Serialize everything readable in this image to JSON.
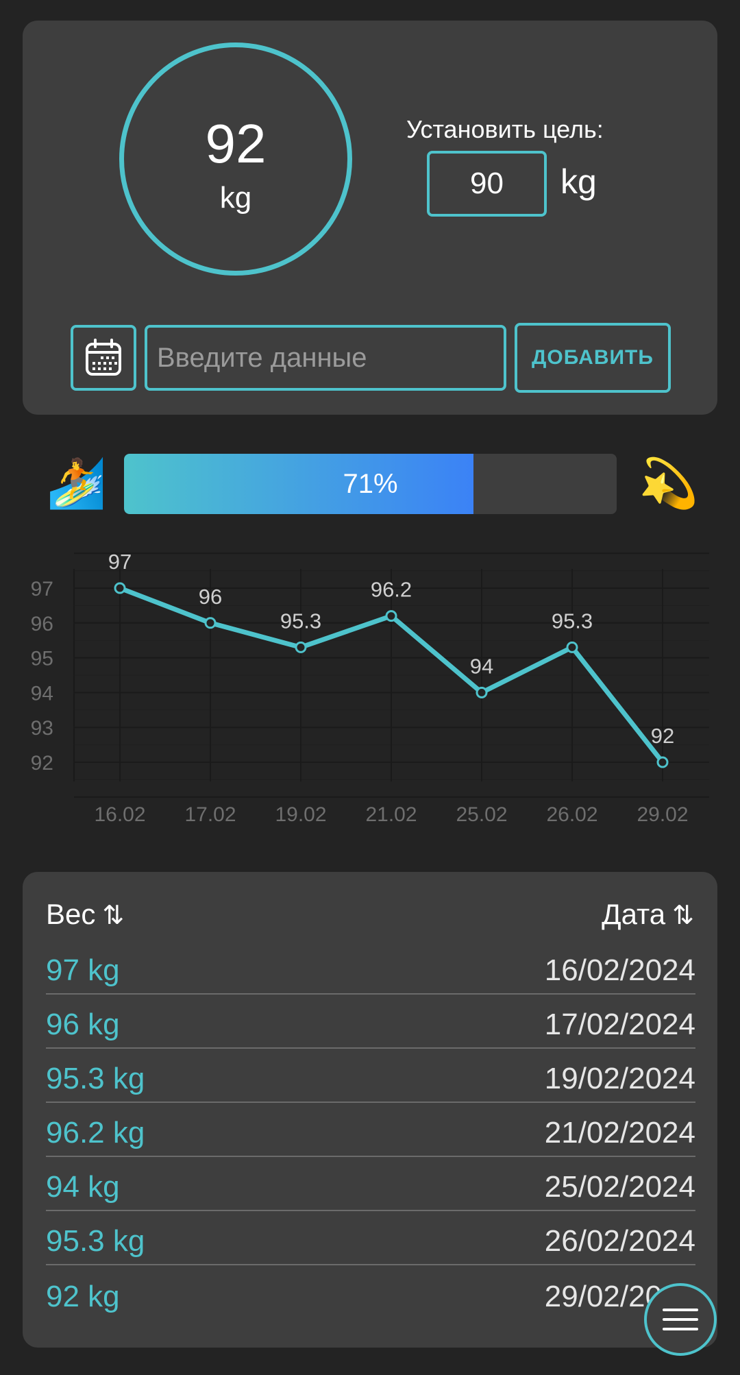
{
  "current": {
    "value": "92",
    "unit": "kg"
  },
  "goal": {
    "label": "Установить цель:",
    "value": "90",
    "unit": "kg"
  },
  "entry": {
    "placeholder": "Введите данные",
    "add_label": "ДОБАВИТЬ"
  },
  "progress": {
    "percent": 71,
    "label": "71%",
    "start_emoji": "🏄",
    "end_emoji": "💫"
  },
  "chart_data": {
    "type": "line",
    "x": [
      "16.02",
      "17.02",
      "19.02",
      "21.02",
      "25.02",
      "26.02",
      "29.02"
    ],
    "values": [
      97,
      96,
      95.3,
      96.2,
      94,
      95.3,
      92
    ],
    "data_labels": [
      "97",
      "96",
      "95.3",
      "96.2",
      "94",
      "95.3",
      "92"
    ],
    "yticks": [
      "97",
      "96",
      "95",
      "94",
      "93",
      "92"
    ],
    "ylim": [
      91.5,
      97.5
    ],
    "grid": true,
    "color": "#4ec3cc"
  },
  "history": {
    "weight_header": "Вес",
    "date_header": "Дата",
    "rows": [
      {
        "weight": "97 kg",
        "date": "16/02/2024"
      },
      {
        "weight": "96 kg",
        "date": "17/02/2024"
      },
      {
        "weight": "95.3 kg",
        "date": "19/02/2024"
      },
      {
        "weight": "96.2 kg",
        "date": "21/02/2024"
      },
      {
        "weight": "94 kg",
        "date": "25/02/2024"
      },
      {
        "weight": "95.3 kg",
        "date": "26/02/2024"
      },
      {
        "weight": "92 kg",
        "date": "29/02/2024"
      }
    ]
  },
  "colors": {
    "accent": "#4ec3cc",
    "background": "#232323",
    "card": "#3e3e3e",
    "progress_end": "#3b82f6"
  },
  "icons": {
    "calendar": "calendar-icon",
    "sort": "sort-arrows-icon",
    "menu": "hamburger-menu-icon"
  }
}
